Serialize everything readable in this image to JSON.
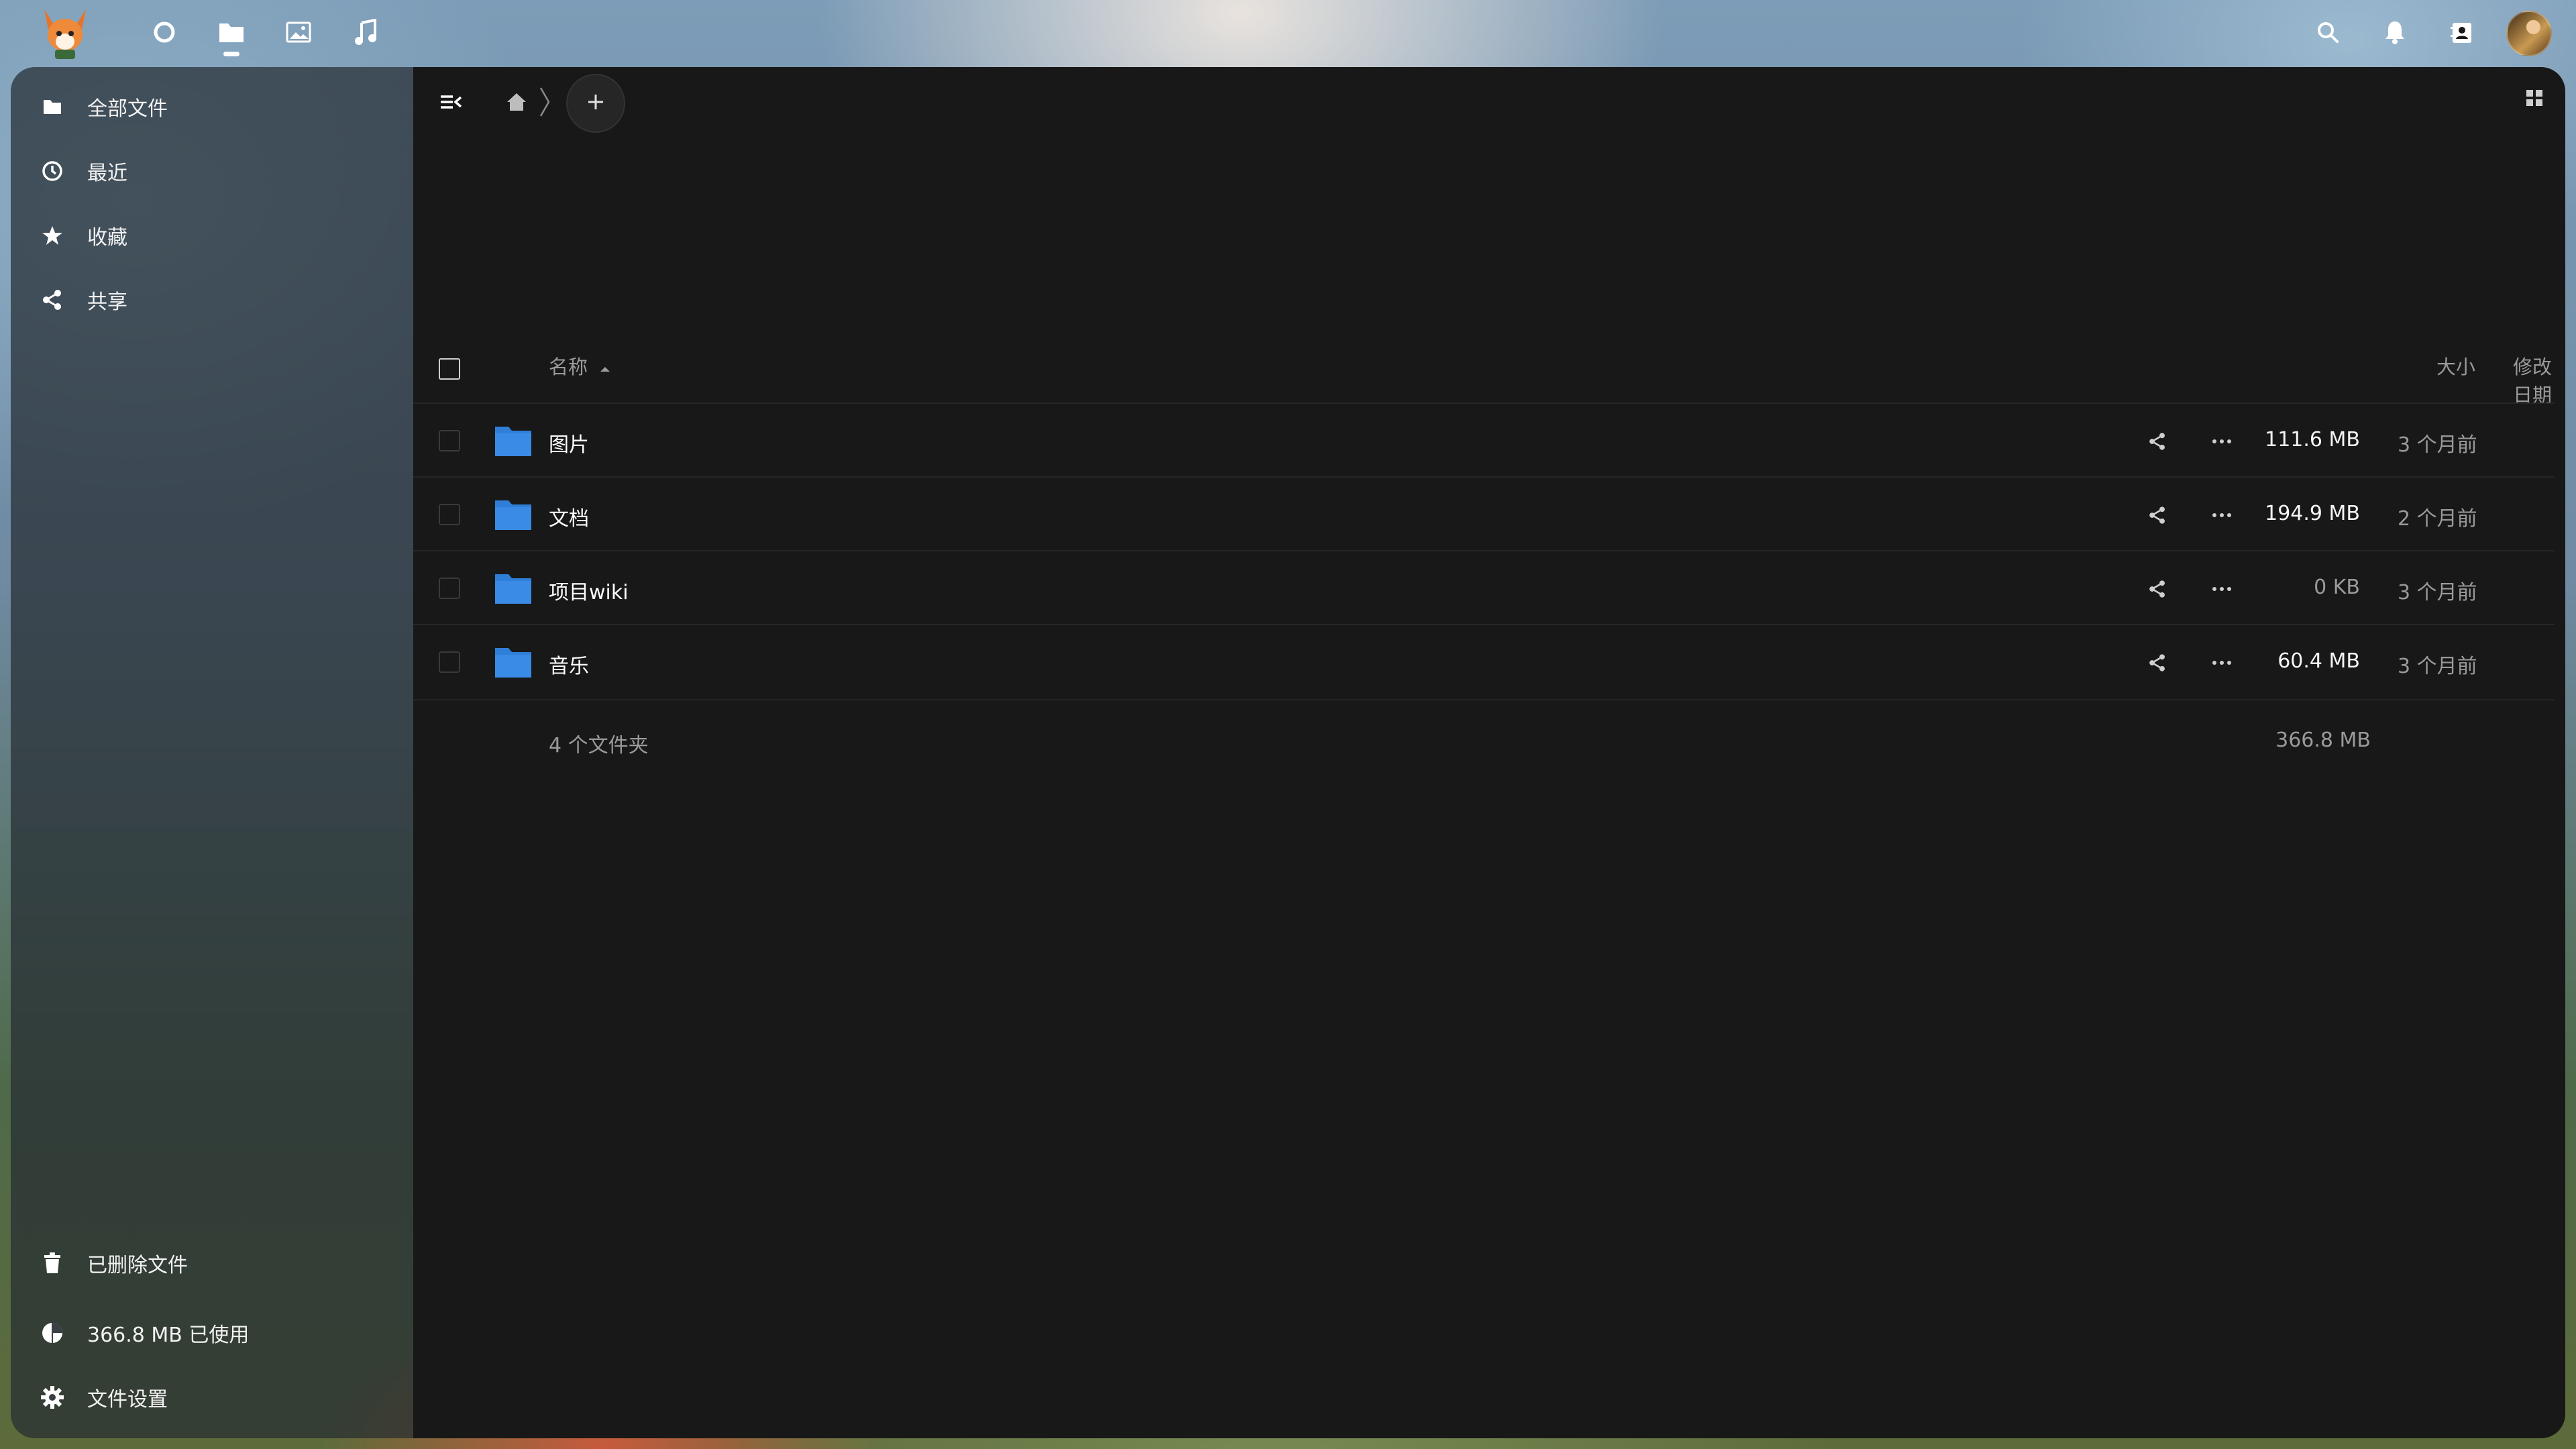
{
  "apps": [
    {
      "name": "dashboard-icon",
      "active": false
    },
    {
      "name": "files-icon",
      "active": true
    },
    {
      "name": "photos-icon",
      "active": false
    },
    {
      "name": "music-icon",
      "active": false
    }
  ],
  "topbar": {
    "icons": [
      "search-icon",
      "bell-icon",
      "contacts-icon",
      "avatar"
    ]
  },
  "sidebar": {
    "items": [
      {
        "label": "全部文件",
        "icon": "folder-icon"
      },
      {
        "label": "最近",
        "icon": "clock-icon"
      },
      {
        "label": "收藏",
        "icon": "star-icon"
      },
      {
        "label": "共享",
        "icon": "share-icon"
      }
    ],
    "deleted": "已删除文件",
    "quota": "366.8 MB 已使用",
    "settings": "文件设置"
  },
  "table": {
    "headers": {
      "name": "名称",
      "size": "大小",
      "modified": "修改日期"
    },
    "sort": "ascending",
    "rows": [
      {
        "name": "图片",
        "size": "111.6 MB",
        "modified": "3 个月前"
      },
      {
        "name": "文档",
        "size": "194.9 MB",
        "modified": "2 个月前"
      },
      {
        "name": "项目wiki",
        "size": "0 KB",
        "modified": "3 个月前"
      },
      {
        "name": "音乐",
        "size": "60.4 MB",
        "modified": "3 个月前"
      }
    ],
    "summary": {
      "count": "4 个文件夹",
      "total": "366.8 MB"
    }
  },
  "colors": {
    "folder": "#2f7fd8",
    "background": "#181818",
    "sidebar": "#262c32"
  }
}
